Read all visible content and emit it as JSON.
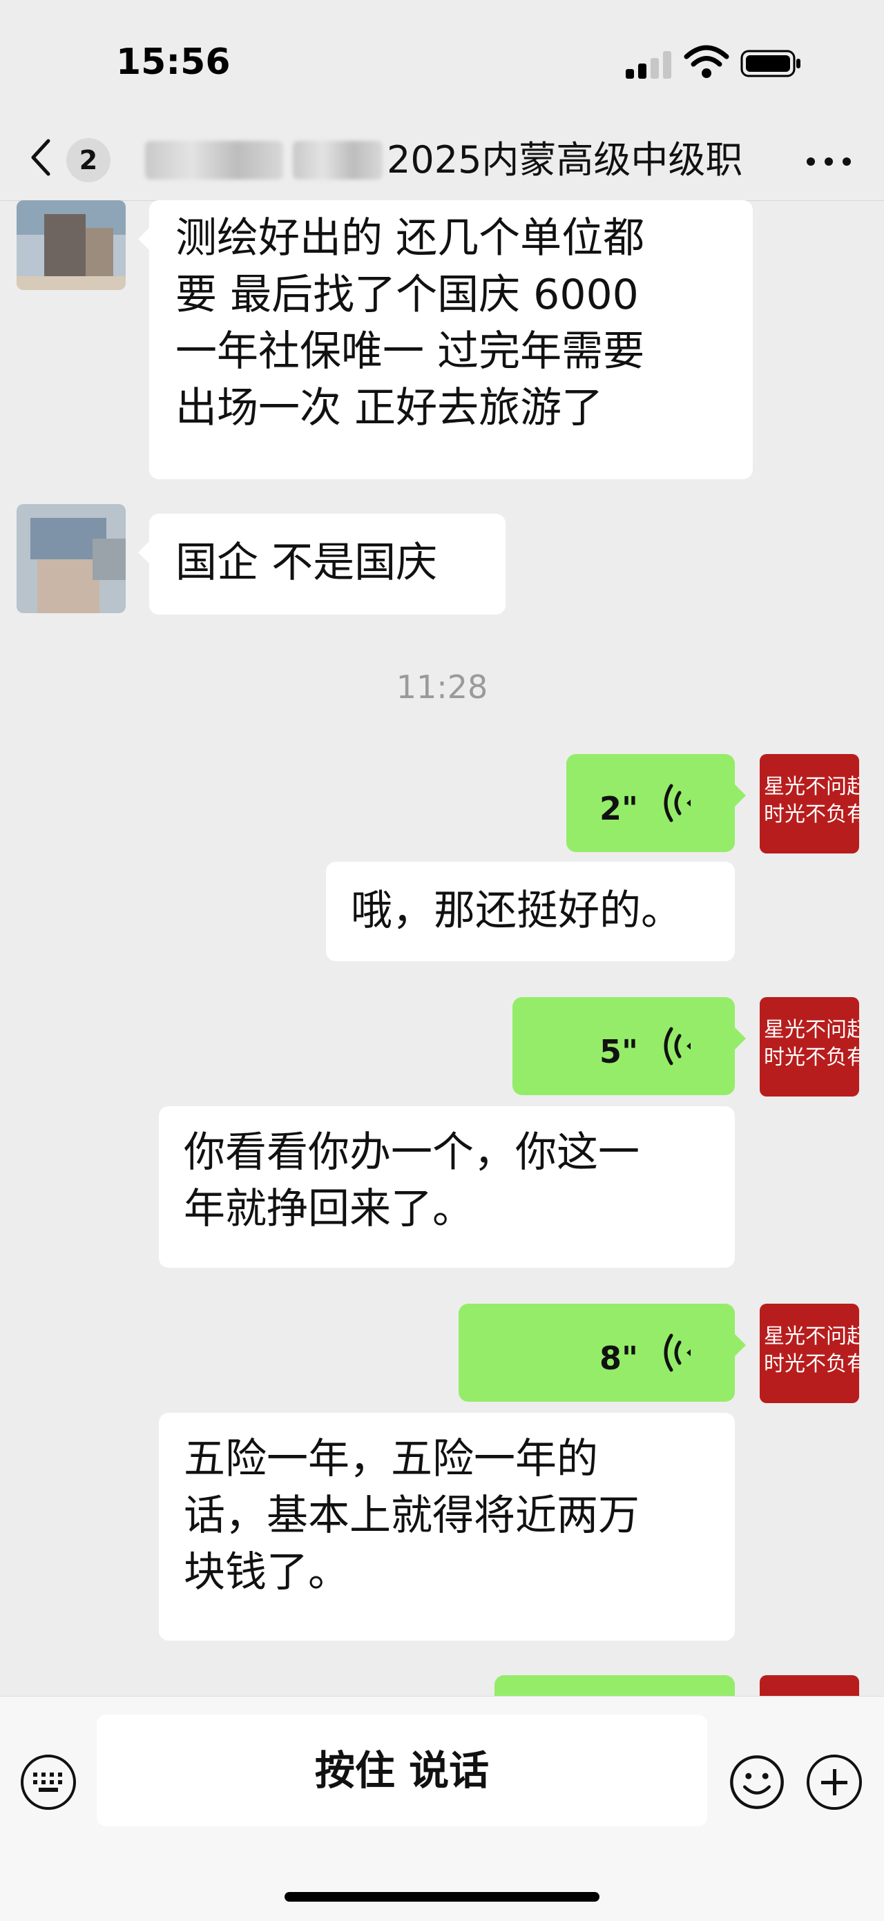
{
  "status_bar": {
    "time": "15:56"
  },
  "header": {
    "back_badge": "2",
    "title": "2025内蒙高级中级职"
  },
  "messages": [
    {
      "from": "other",
      "text": [
        "测绘好出的  还几个单位都",
        "要  最后找了个国庆  6000",
        "一年社保唯一  过完年需要",
        "出场一次  正好去旅游了"
      ]
    },
    {
      "from": "other",
      "text": [
        "国企  不是国庆"
      ]
    },
    {
      "type": "timestamp",
      "text": "11:28"
    },
    {
      "from": "self",
      "type": "voice",
      "duration": "2\""
    },
    {
      "from": "self",
      "type": "transcript",
      "text": [
        "哦，那还挺好的。"
      ]
    },
    {
      "from": "self",
      "type": "voice",
      "duration": "5\""
    },
    {
      "from": "self",
      "type": "transcript",
      "text": [
        "你看看你办一个，你这一",
        "年就挣回来了。"
      ]
    },
    {
      "from": "self",
      "type": "voice",
      "duration": "8\""
    },
    {
      "from": "self",
      "type": "transcript",
      "text": [
        "五险一年，五险一年的",
        "话，基本上就得将近两万",
        "块钱了。"
      ]
    }
  ],
  "self_avatar_text": [
    "星光不问赶路",
    "时光不负有心"
  ],
  "input_bar": {
    "talk_label": "按住 说话"
  },
  "icons": [
    "back-icon",
    "more-icon",
    "voice-wave-icon",
    "keyboard-icon",
    "emoji-icon",
    "plus-icon"
  ],
  "colors": {
    "background": "#ededed",
    "self_bubble": "#95ec69",
    "other_bubble": "#ffffff",
    "avatar_red": "#b81d1d"
  }
}
